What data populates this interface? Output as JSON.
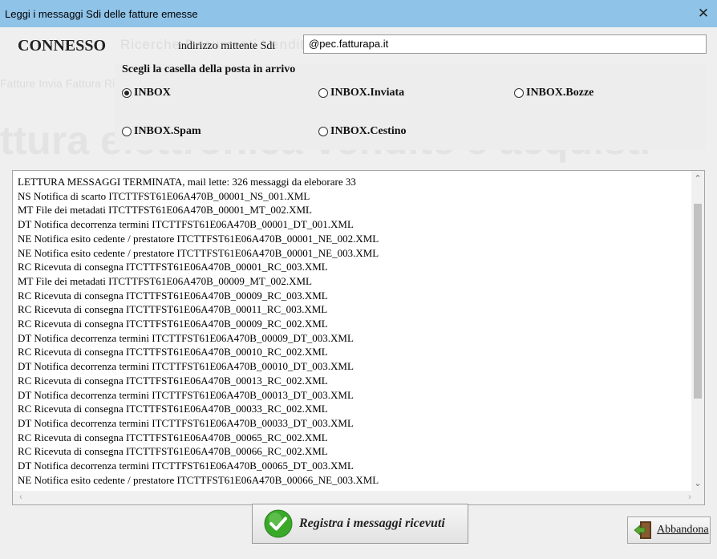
{
  "window": {
    "title": "Leggi i messaggi Sdi delle fatture emesse",
    "close_glyph": "✕"
  },
  "status": "CONNESSO",
  "sender": {
    "label": "indirizzo mittente Sdi",
    "value": "@pec.fatturapa.it"
  },
  "inbox_group": {
    "title": "Scegli la casella della posta in arrivo",
    "selected": "INBOX",
    "options": [
      "INBOX",
      "INBOX.Inviata",
      "INBOX.Bozze",
      "INBOX.Spam",
      "INBOX.Cestino"
    ]
  },
  "log": {
    "lines": [
      "LETTURA MESSAGGI TERMINATA, mail lette: 326 messaggi da eleborare 33",
      "NS Notifica di scarto ITCTTFST61E06A470B_00001_NS_001.XML",
      "MT File dei metadati ITCTTFST61E06A470B_00001_MT_002.XML",
      "DT Notifica decorrenza termini ITCTTFST61E06A470B_00001_DT_001.XML",
      "NE Notifica esito cedente / prestatore ITCTTFST61E06A470B_00001_NE_002.XML",
      "NE Notifica esito cedente / prestatore ITCTTFST61E06A470B_00001_NE_003.XML",
      "RC Ricevuta di consegna ITCTTFST61E06A470B_00001_RC_003.XML",
      "MT File dei metadati ITCTTFST61E06A470B_00009_MT_002.XML",
      "RC Ricevuta di consegna ITCTTFST61E06A470B_00009_RC_003.XML",
      "RC Ricevuta di consegna ITCTTFST61E06A470B_00011_RC_003.XML",
      "RC Ricevuta di consegna ITCTTFST61E06A470B_00009_RC_002.XML",
      "DT Notifica decorrenza termini ITCTTFST61E06A470B_00009_DT_003.XML",
      "RC Ricevuta di consegna ITCTTFST61E06A470B_00010_RC_002.XML",
      "DT Notifica decorrenza termini ITCTTFST61E06A470B_00010_DT_003.XML",
      "RC Ricevuta di consegna ITCTTFST61E06A470B_00013_RC_002.XML",
      "DT Notifica decorrenza termini ITCTTFST61E06A470B_00013_DT_003.XML",
      "RC Ricevuta di consegna ITCTTFST61E06A470B_00033_RC_002.XML",
      "DT Notifica decorrenza termini ITCTTFST61E06A470B_00033_DT_003.XML",
      "RC Ricevuta di consegna ITCTTFST61E06A470B_00065_RC_002.XML",
      "RC Ricevuta di consegna ITCTTFST61E06A470B_00066_RC_002.XML",
      "DT Notifica decorrenza termini ITCTTFST61E06A470B_00065_DT_003.XML",
      "NE Notifica esito cedente / prestatore ITCTTFST61E06A470B_00066_NE_003.XML"
    ]
  },
  "buttons": {
    "register": "Registra i messaggi ricevuti",
    "cancel": "Abbandona"
  },
  "background_text": {
    "menu": "Ricerche   Documenti   Vendite   Sdi   Stampe   Dati ditta",
    "submenu": "Fatture   Invia Fattura   Ricevi fattura   Fattura pa",
    "headline": "ttura elettronica vendite e acquisti"
  },
  "icons": {
    "radio": "radio-button-icon",
    "register": "green-check-icon",
    "cancel": "exit-door-icon",
    "scroll_up": "chevron-up-icon",
    "scroll_down": "chevron-down-icon",
    "scroll_left": "chevron-left-icon",
    "scroll_right": "chevron-right-icon"
  },
  "colors": {
    "titlebar": "#8fc3e8",
    "check_green": "#3aa92a",
    "exit_green": "#5aa834"
  }
}
